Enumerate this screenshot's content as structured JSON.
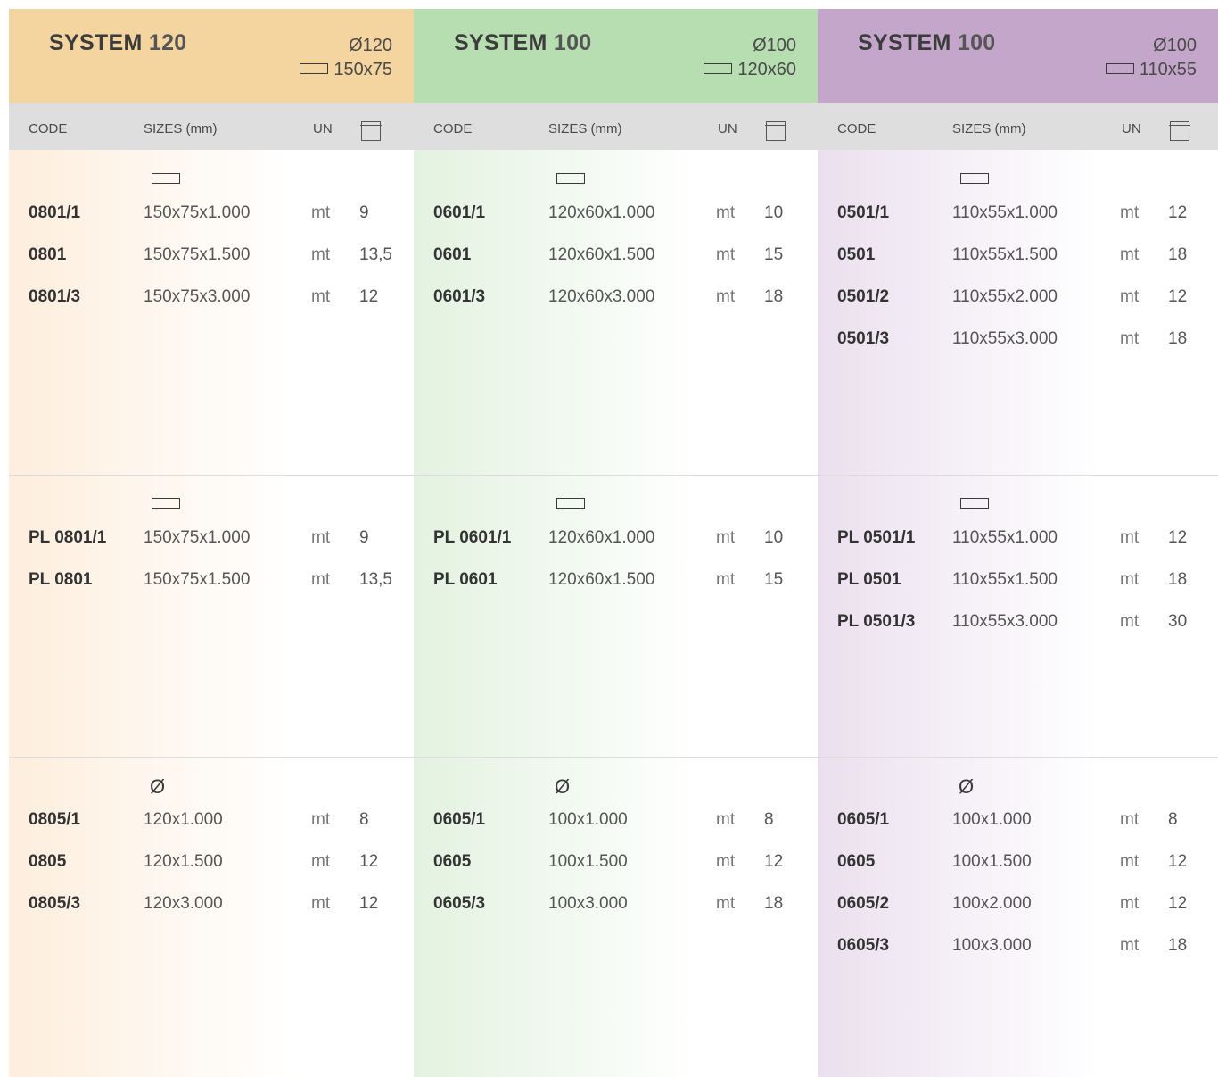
{
  "columns": [
    {
      "title_word": "SYSTEM",
      "title_num": "120",
      "spec_diameter": "Ø120",
      "spec_rect": "150x75",
      "head_color": "#f5d59f",
      "grad_color": "#fdeedd",
      "headers": {
        "code": "CODE",
        "sizes": "SIZES (mm)",
        "un": "UN"
      },
      "sections": [
        {
          "icon": "rectangle",
          "rows": [
            {
              "code": "0801/1",
              "size": "150x75x1.000",
              "un": "mt",
              "qty": "9"
            },
            {
              "code": "0801",
              "size": "150x75x1.500",
              "un": "mt",
              "qty": "13,5"
            },
            {
              "code": "0801/3",
              "size": "150x75x3.000",
              "un": "mt",
              "qty": "12"
            }
          ]
        },
        {
          "icon": "rectangle",
          "rows": [
            {
              "code": "PL 0801/1",
              "size": "150x75x1.000",
              "un": "mt",
              "qty": "9"
            },
            {
              "code": "PL 0801",
              "size": "150x75x1.500",
              "un": "mt",
              "qty": "13,5"
            }
          ]
        },
        {
          "icon": "diameter",
          "icon_text": "Ø",
          "rows": [
            {
              "code": "0805/1",
              "size": "120x1.000",
              "un": "mt",
              "qty": "8"
            },
            {
              "code": "0805",
              "size": "120x1.500",
              "un": "mt",
              "qty": "12"
            },
            {
              "code": "0805/3",
              "size": "120x3.000",
              "un": "mt",
              "qty": "12"
            }
          ]
        }
      ]
    },
    {
      "title_word": "SYSTEM",
      "title_num": "100",
      "spec_diameter": "Ø100",
      "spec_rect": "120x60",
      "head_color": "#b6deb0",
      "grad_color": "#e3f2e0",
      "headers": {
        "code": "CODE",
        "sizes": "SIZES (mm)",
        "un": "UN"
      },
      "sections": [
        {
          "icon": "rectangle",
          "rows": [
            {
              "code": "0601/1",
              "size": "120x60x1.000",
              "un": "mt",
              "qty": "10"
            },
            {
              "code": "0601",
              "size": "120x60x1.500",
              "un": "mt",
              "qty": "15"
            },
            {
              "code": "0601/3",
              "size": "120x60x3.000",
              "un": "mt",
              "qty": "18"
            }
          ]
        },
        {
          "icon": "rectangle",
          "rows": [
            {
              "code": "PL 0601/1",
              "size": "120x60x1.000",
              "un": "mt",
              "qty": "10"
            },
            {
              "code": "PL 0601",
              "size": "120x60x1.500",
              "un": "mt",
              "qty": "15"
            }
          ]
        },
        {
          "icon": "diameter",
          "icon_text": "Ø",
          "rows": [
            {
              "code": "0605/1",
              "size": "100x1.000",
              "un": "mt",
              "qty": "8"
            },
            {
              "code": "0605",
              "size": "100x1.500",
              "un": "mt",
              "qty": "12"
            },
            {
              "code": "0605/3",
              "size": "100x3.000",
              "un": "mt",
              "qty": "18"
            }
          ]
        }
      ]
    },
    {
      "title_word": "SYSTEM",
      "title_num": "100",
      "spec_diameter": "Ø100",
      "spec_rect": "110x55",
      "head_color": "#c3a6ca",
      "grad_color": "#ebe0ee",
      "headers": {
        "code": "CODE",
        "sizes": "SIZES (mm)",
        "un": "UN"
      },
      "sections": [
        {
          "icon": "rectangle",
          "rows": [
            {
              "code": "0501/1",
              "size": "110x55x1.000",
              "un": "mt",
              "qty": "12"
            },
            {
              "code": "0501",
              "size": "110x55x1.500",
              "un": "mt",
              "qty": "18"
            },
            {
              "code": "0501/2",
              "size": "110x55x2.000",
              "un": "mt",
              "qty": "12"
            },
            {
              "code": "0501/3",
              "size": "110x55x3.000",
              "un": "mt",
              "qty": "18"
            }
          ]
        },
        {
          "icon": "rectangle",
          "rows": [
            {
              "code": "PL 0501/1",
              "size": "110x55x1.000",
              "un": "mt",
              "qty": "12"
            },
            {
              "code": "PL 0501",
              "size": "110x55x1.500",
              "un": "mt",
              "qty": "18"
            },
            {
              "code": "PL 0501/3",
              "size": "110x55x3.000",
              "un": "mt",
              "qty": "30"
            }
          ]
        },
        {
          "icon": "diameter",
          "icon_text": "Ø",
          "rows": [
            {
              "code": "0605/1",
              "size": "100x1.000",
              "un": "mt",
              "qty": "8"
            },
            {
              "code": "0605",
              "size": "100x1.500",
              "un": "mt",
              "qty": "12"
            },
            {
              "code": "0605/2",
              "size": "100x2.000",
              "un": "mt",
              "qty": "12"
            },
            {
              "code": "0605/3",
              "size": "100x3.000",
              "un": "mt",
              "qty": "18"
            }
          ]
        }
      ]
    }
  ]
}
